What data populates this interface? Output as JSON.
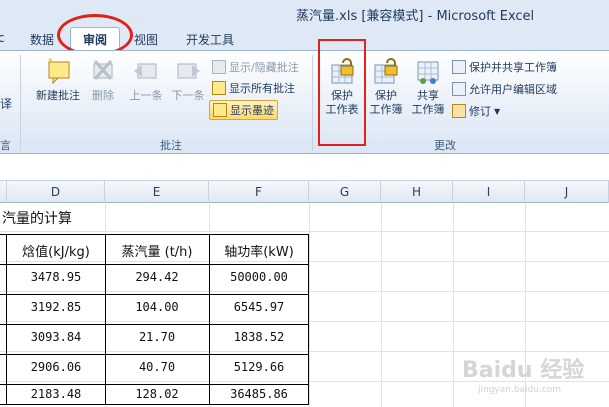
{
  "title": "蒸汽量.xls  [兼容模式]  -  Microsoft Excel",
  "tabs": [
    {
      "label": "c",
      "active": false
    },
    {
      "label": "数据",
      "active": false
    },
    {
      "label": "审阅",
      "active": true
    },
    {
      "label": "视图",
      "active": false
    },
    {
      "label": "开发工具",
      "active": false
    }
  ],
  "ribbon": {
    "left_fragment_top": "译",
    "left_fragment_bottom": "言",
    "comments_group": {
      "label": "批注",
      "new_comment": "新建批注",
      "delete": "删除",
      "previous": "上一条",
      "next": "下一条",
      "show_hide": "显示/隐藏批注",
      "show_all": "显示所有批注",
      "show_ink": "显示墨迹"
    },
    "changes_group": {
      "label": "更改",
      "protect_sheet_line1": "保护",
      "protect_sheet_line2": "工作表",
      "protect_workbook_line1": "保护",
      "protect_workbook_line2": "工作簿",
      "share_workbook_line1": "共享",
      "share_workbook_line2": "工作簿",
      "protect_share": "保护并共享工作簿",
      "allow_edit_ranges": "允许用户编辑区域",
      "track_changes": "修订"
    }
  },
  "columns": [
    "D",
    "E",
    "F",
    "G",
    "H",
    "I",
    "J"
  ],
  "sheet": {
    "title_fragment": "汽量的计算",
    "headers": [
      "焓值(kJ/kg)",
      "蒸汽量 (t/h)",
      "轴功率(kW)"
    ],
    "rows": [
      [
        "3478.95",
        "294.42",
        "50000.00"
      ],
      [
        "3192.85",
        "104.00",
        "6545.97"
      ],
      [
        "3093.84",
        "21.70",
        "1838.52"
      ],
      [
        "2906.06",
        "40.70",
        "5129.66"
      ],
      [
        "2183.48",
        "128.02",
        "36485.86"
      ]
    ]
  },
  "watermark": {
    "brand": "Baidu 经验",
    "url": "jingyan.baidu.com"
  },
  "colors": {
    "annotation_red": "#e0221b",
    "ribbon_bg": "#dfe9f5"
  }
}
